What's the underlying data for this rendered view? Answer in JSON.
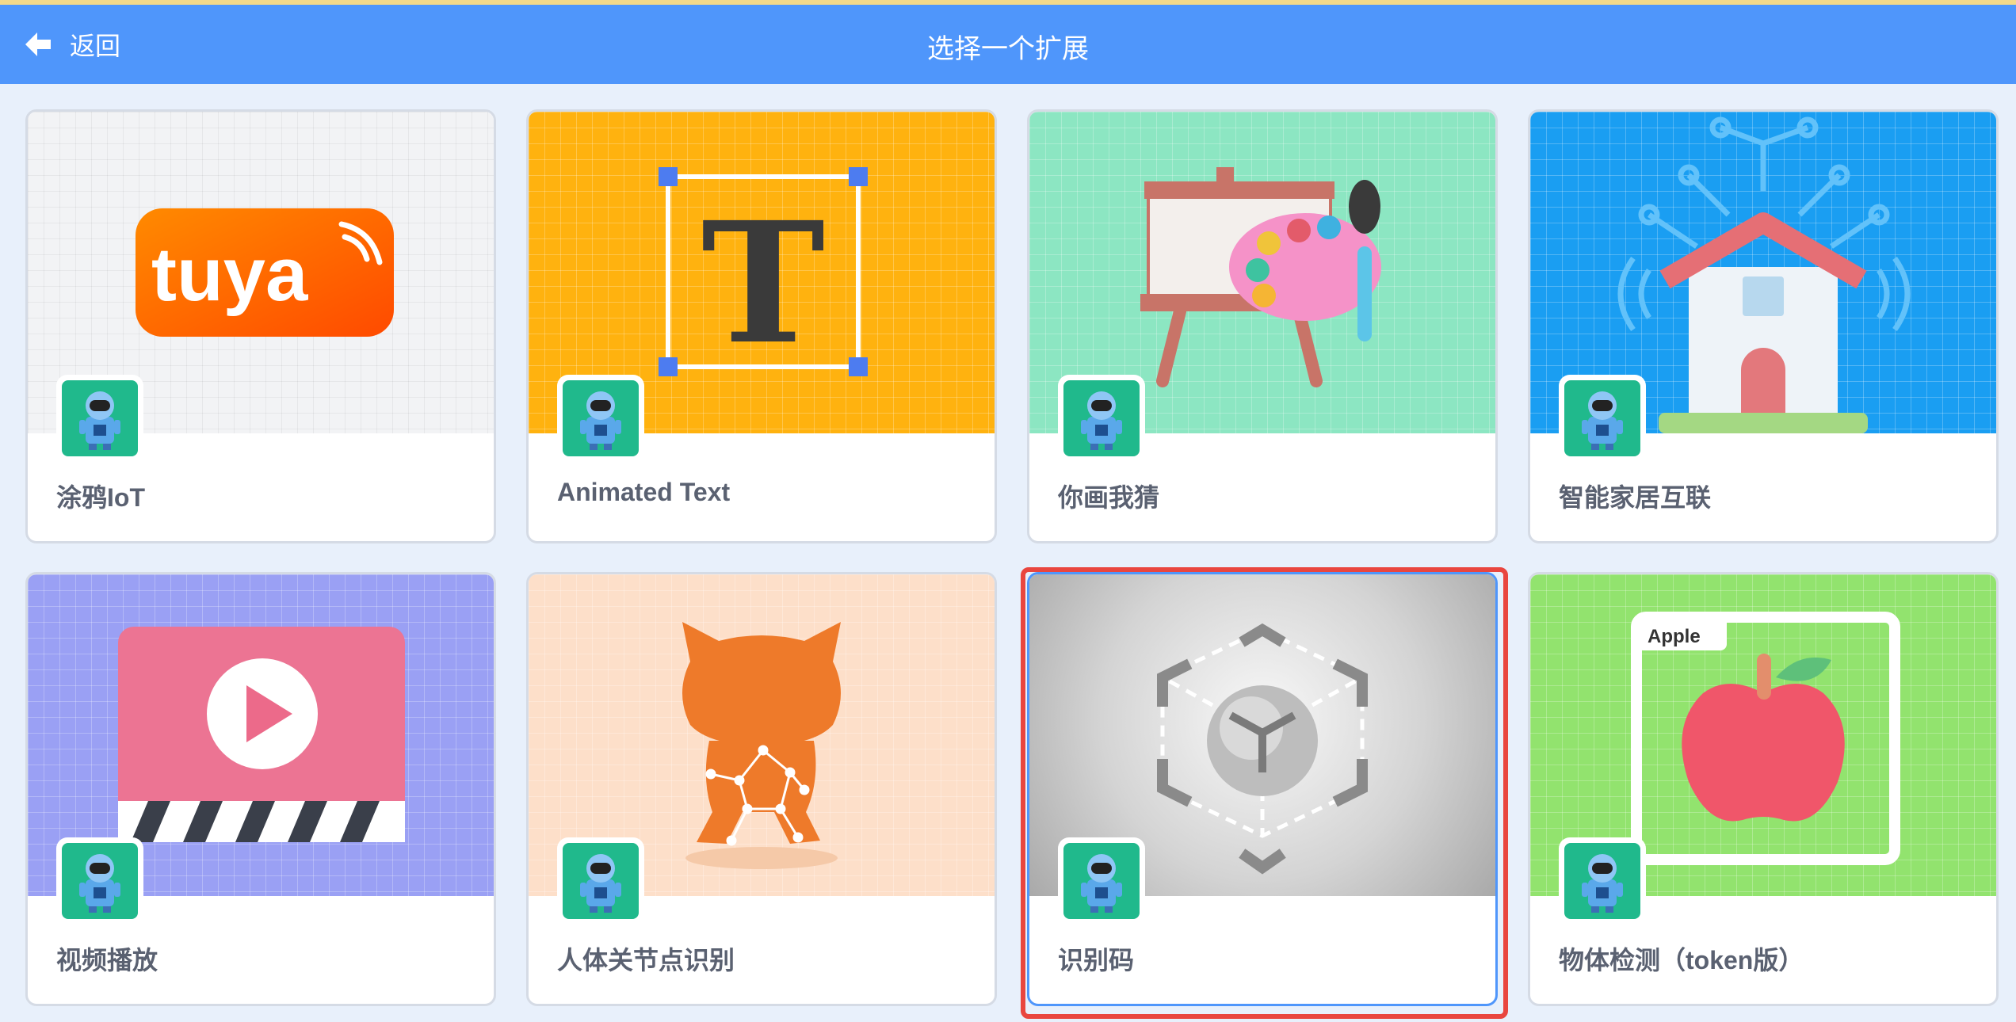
{
  "header": {
    "back_label": "返回",
    "title": "选择一个扩展",
    "back_icon": "arrow-left-icon",
    "bg_color": "#4f96fb"
  },
  "extensions": [
    {
      "label": "涂鸦IoT",
      "art_text": "tuya",
      "bg": "#f2f3f5"
    },
    {
      "label": "Animated Text",
      "art_text": "T",
      "bg": "#ffb20f"
    },
    {
      "label": "你画我猜",
      "bg": "#8ce6c2"
    },
    {
      "label": "智能家居互联",
      "bg": "#1a9ef2"
    },
    {
      "label": "视频播放",
      "bg": "#9aa0f4"
    },
    {
      "label": "人体关节点识别",
      "bg": "#fddfc9"
    },
    {
      "label": "识别码",
      "bg": "#cfcfcf",
      "selected": true
    },
    {
      "label": "物体检测（token版）",
      "art_text": "Apple",
      "bg": "#92e36e"
    }
  ],
  "badge_icon": "robot-icon",
  "selection_color": "#e9463f"
}
